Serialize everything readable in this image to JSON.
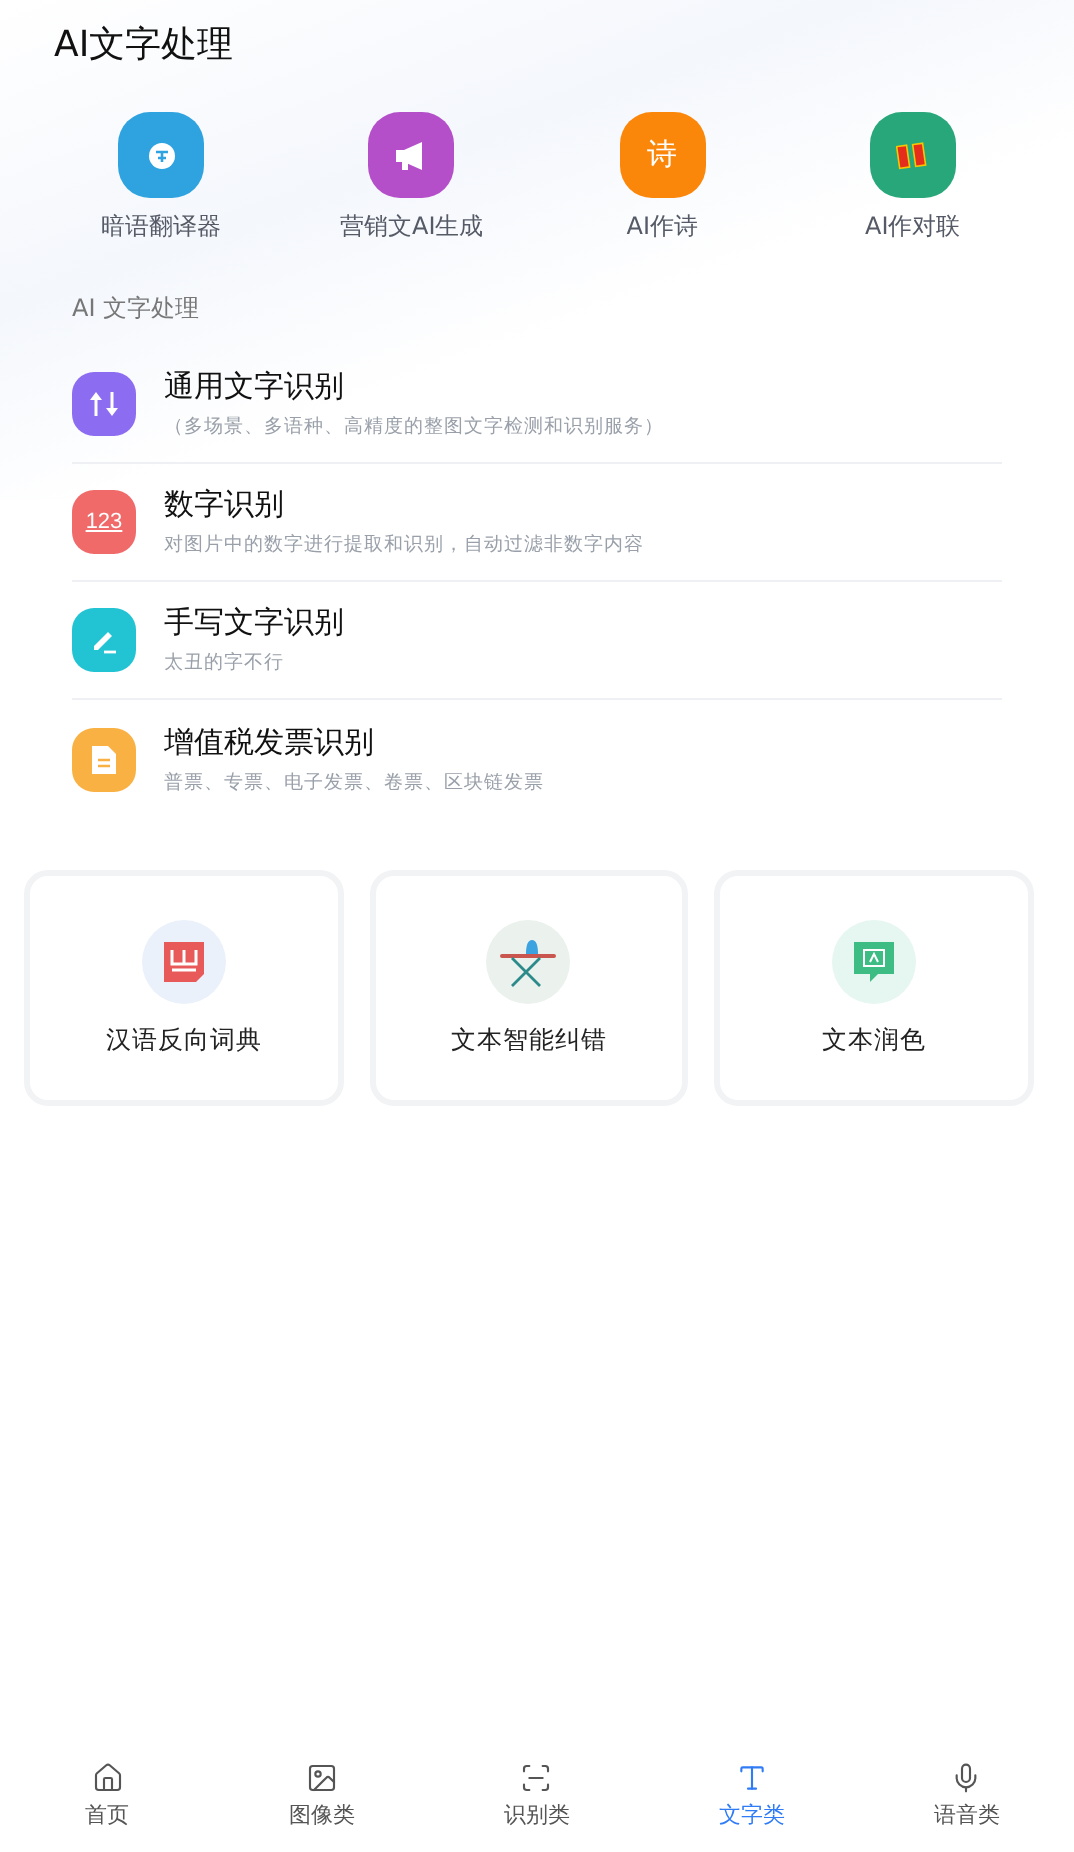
{
  "title": "AI文字处理",
  "shortcuts": [
    {
      "label": "暗语翻译器",
      "color": "#2fa3e0"
    },
    {
      "label": "营销文AI生成",
      "color": "#b44fc9"
    },
    {
      "label": "AI作诗",
      "glyph": "诗",
      "color": "#fb870a"
    },
    {
      "label": "AI作对联",
      "color": "#27a77a"
    }
  ],
  "section_title": "AI 文字处理",
  "features": [
    {
      "title": "通用文字识别",
      "subtitle": "（多场景、多语种、高精度的整图文字检测和识别服务）",
      "color": "#8c6cf0"
    },
    {
      "title": "数字识别",
      "subtitle": "对图片中的数字进行提取和识别，自动过滤非数字内容",
      "glyph": "123",
      "color": "#f06a6a"
    },
    {
      "title": "手写文字识别",
      "subtitle": "太丑的字不行",
      "color": "#22c3d3"
    },
    {
      "title": "增值税发票识别",
      "subtitle": "普票、专票、电子发票、卷票、区块链发票",
      "color": "#f9b143"
    }
  ],
  "cards": [
    {
      "label": "汉语反向词典",
      "color": "#eaf1fb"
    },
    {
      "label": "文本智能纠错",
      "color": "#ebf1ec"
    },
    {
      "label": "文本润色",
      "color": "#e6f6f1"
    }
  ],
  "tabs": [
    {
      "label": "首页",
      "selected": false
    },
    {
      "label": "图像类",
      "selected": false
    },
    {
      "label": "识别类",
      "selected": false
    },
    {
      "label": "文字类",
      "selected": true
    },
    {
      "label": "语音类",
      "selected": false
    }
  ]
}
